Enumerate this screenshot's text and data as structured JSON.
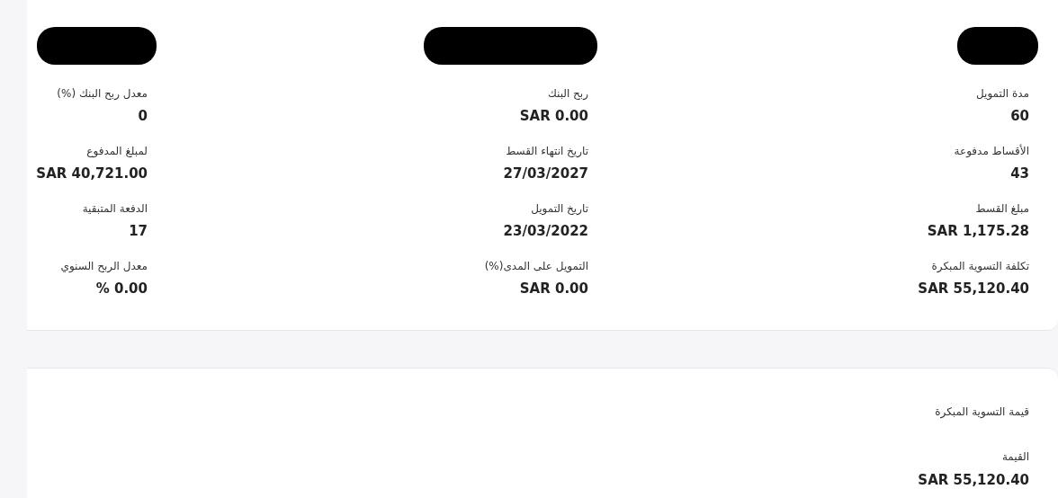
{
  "redactions": [
    {
      "redacted": true
    },
    {
      "redacted": true
    },
    {
      "redacted": true
    }
  ],
  "columns": [
    {
      "fields": [
        {
          "label": "مدة التمويل",
          "value": "60"
        },
        {
          "label": "الأقساط مدفوعة",
          "value": "43"
        },
        {
          "label": "مبلغ القسط",
          "value": "SAR 1,175.28"
        },
        {
          "label": "تكلفة التسوية المبكرة",
          "value": "SAR 55,120.40"
        }
      ]
    },
    {
      "fields": [
        {
          "label": "ربح البنك",
          "value": "SAR 0.00"
        },
        {
          "label": "تاريخ انتهاء القسط",
          "value": "27/03/2027"
        },
        {
          "label": "تاريخ التمويل",
          "value": "23/03/2022"
        },
        {
          "label": "التمويل على المدى(%)",
          "value": "SAR 0.00"
        }
      ]
    },
    {
      "fields": [
        {
          "label": "معدل ربح البنك (%)",
          "value": "0"
        },
        {
          "label": "لمبلغ المدفوع",
          "value": "SAR 40,721.00"
        },
        {
          "label": "الدفعة المتبقية",
          "value": "17"
        },
        {
          "label": "معدل الربح السنوي",
          "value": "% 0.00"
        }
      ]
    }
  ],
  "settlement": {
    "title": "قيمة التسوية المبكرة",
    "label": "القيمة",
    "value": "SAR 55,120.40"
  }
}
